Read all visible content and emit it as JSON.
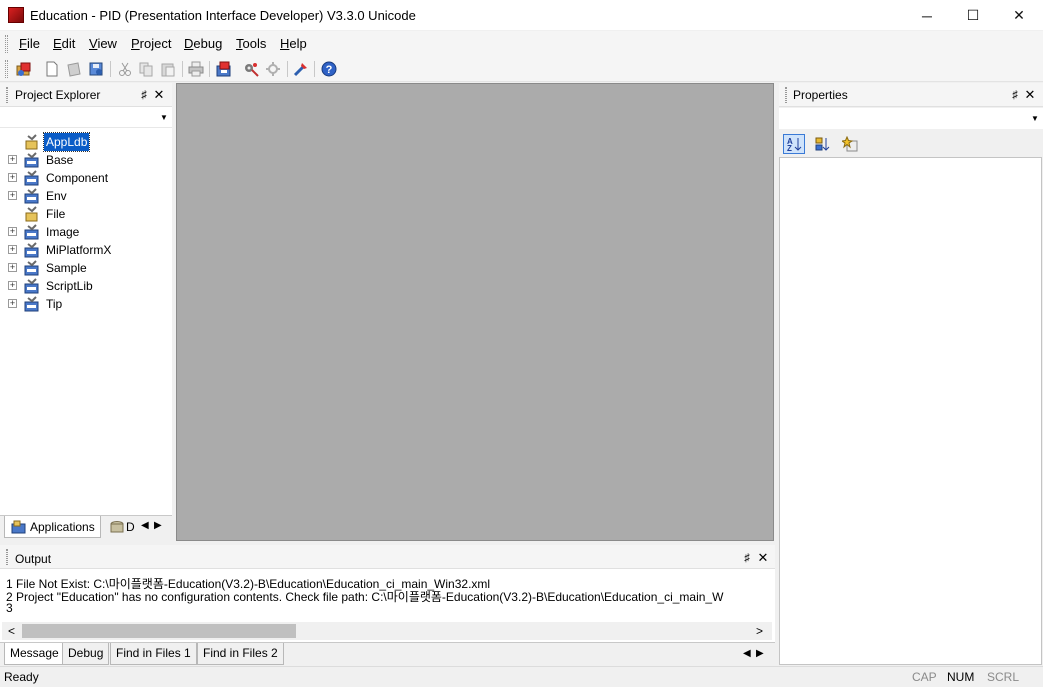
{
  "window": {
    "title": "Education - PID (Presentation Interface Developer) V3.3.0 Unicode",
    "controls": {
      "minimize": "─",
      "maximize": "☐",
      "close": "✕"
    }
  },
  "menu": [
    {
      "label": "File",
      "mnemonic": "F",
      "rest": "ile"
    },
    {
      "label": "Edit",
      "mnemonic": "E",
      "rest": "dit"
    },
    {
      "label": "View",
      "mnemonic": "V",
      "rest": "iew"
    },
    {
      "label": "Project",
      "mnemonic": "P",
      "rest": "roject"
    },
    {
      "label": "Debug",
      "mnemonic": "D",
      "rest": "ebug"
    },
    {
      "label": "Tools",
      "mnemonic": "T",
      "rest": "ools"
    },
    {
      "label": "Help",
      "mnemonic": "H",
      "rest": "elp"
    }
  ],
  "toolbar_icons": [
    "open-project-icon",
    "new-file-icon",
    "save-icon",
    "save-all-icon",
    "cut-icon",
    "copy-icon",
    "paste-icon",
    "print-icon",
    "build-icon",
    "run-icon",
    "debug-icon",
    "options-icon",
    "help-icon"
  ],
  "project_explorer": {
    "title": "Project Explorer",
    "pin": "♯",
    "close": "✕",
    "tree": [
      {
        "label": "AppLdb",
        "expandable": false,
        "selected": true
      },
      {
        "label": "Base",
        "expandable": true
      },
      {
        "label": "Component",
        "expandable": true
      },
      {
        "label": "Env",
        "expandable": true
      },
      {
        "label": "File",
        "expandable": false
      },
      {
        "label": "Image",
        "expandable": true
      },
      {
        "label": "MiPlatformX",
        "expandable": true
      },
      {
        "label": "Sample",
        "expandable": true
      },
      {
        "label": "ScriptLib",
        "expandable": true
      },
      {
        "label": "Tip",
        "expandable": true
      }
    ],
    "tabs": {
      "applications": "Applications",
      "database_partial": "D"
    }
  },
  "properties": {
    "title": "Properties",
    "pin": "♯",
    "close": "✕"
  },
  "output": {
    "title": "Output",
    "lines": [
      "1 File Not Exist: C:\\마이플랫폼-Education(V3.2)-B\\Education\\Education_ci_main_Win32.xml",
      "2 Project \"Education\" has no configuration contents. Check file path: C:\\마이플랫폼-Education(V3.2)-B\\Education\\Education_ci_main_W",
      "3"
    ],
    "tabs": [
      "Message",
      "Debug",
      "Find in Files 1",
      "Find in Files 2"
    ],
    "scroll_left": "<",
    "scroll_right": ">"
  },
  "status": {
    "text": "Ready",
    "indicators": [
      "CAP",
      "NUM",
      "SCRL"
    ]
  },
  "colors": {
    "selection": "#0a5cc7",
    "editor_background": "#ababab"
  }
}
